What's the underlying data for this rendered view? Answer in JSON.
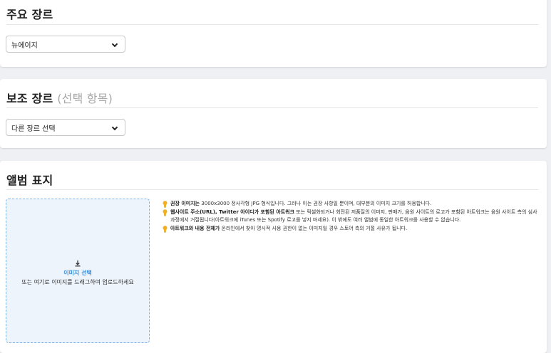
{
  "primary_genre": {
    "title": "주요 장르",
    "select_value": "뉴에이지"
  },
  "secondary_genre": {
    "title": "보조 장르",
    "optional": "(선택 항목)",
    "select_value": "다른 장르 선택"
  },
  "album_cover": {
    "title": "앨범 표지",
    "dropzone": {
      "link": "이미지 선택",
      "hint": "또는 여기로 이미지를 드래그하여 업로드하세요"
    },
    "tips": [
      {
        "bold": "권장 이미지는",
        "text": " 3000x3000 정사각형 JPG 형식입니다. 그러나 이는 권장 사항일 뿐이며, 대부분의 이미지 크기를 허용합니다."
      },
      {
        "bold": "웹사이트 주소(URL), Twitter 아이디가 포함된 아트워크",
        "text": " 또는 픽셀화되거나 회전된 저품질의 이미지, 판매가, 음원 사이트의 로고가 포함된 아트워크는 음원 사이트 측의 심사과정에서 거절됩니다(아트워크에 iTunes 또는 Spotify 로고를 넣지 마세요). 이 밖에도 여러 앨범에 동일한 아트워크를 사용할 수 없습니다."
      },
      {
        "bold": "아트워크와 내용 전체가",
        "text": " 온라인에서 찾아 명시적 사용 권한이 없는 이미지일 경우 스토어 측의 거절 사유가 됩니다."
      }
    ]
  },
  "colors": {
    "accent": "#3d8fdb",
    "tip_icon": "#f2b01e",
    "background": "#eef0f3"
  }
}
